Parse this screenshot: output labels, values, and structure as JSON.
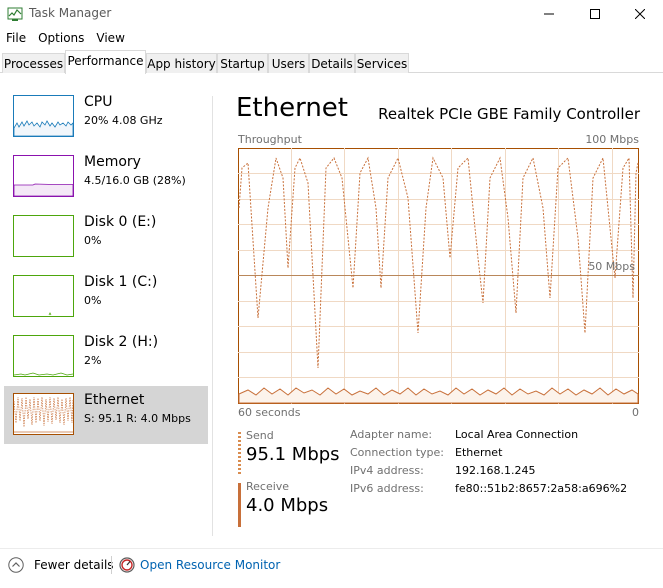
{
  "window": {
    "title": "Task Manager",
    "icon": "task-manager-icon"
  },
  "menu": [
    "File",
    "Options",
    "View"
  ],
  "tabs": [
    "Processes",
    "Performance",
    "App history",
    "Startup",
    "Users",
    "Details",
    "Services"
  ],
  "active_tab": "Performance",
  "sidebar": {
    "items": [
      {
        "title": "CPU",
        "subtitle": "20%  4.08 GHz",
        "color": "#1a7bb9"
      },
      {
        "title": "Memory",
        "subtitle": "4.5/16.0 GB (28%)",
        "color": "#8b12ae"
      },
      {
        "title": "Disk 0 (E:)",
        "subtitle": "0%",
        "color": "#4da60c"
      },
      {
        "title": "Disk 1 (C:)",
        "subtitle": "0%",
        "color": "#4da60c"
      },
      {
        "title": "Disk 2 (H:)",
        "subtitle": "2%",
        "color": "#4da60c"
      },
      {
        "title": "Ethernet",
        "subtitle": "S: 95.1  R: 4.0 Mbps",
        "color": "#a74f01"
      }
    ]
  },
  "main": {
    "title": "Ethernet",
    "device": "Realtek PCIe GBE Family Controller",
    "graph": {
      "label_left": "Throughput",
      "label_max": "100 Mbps",
      "label_mid": "50 Mbps",
      "time_left": "60 seconds",
      "time_right": "0"
    },
    "send": {
      "label": "Send",
      "value": "95.1 Mbps"
    },
    "receive": {
      "label": "Receive",
      "value": "4.0 Mbps"
    },
    "details": [
      {
        "key": "Adapter name:",
        "value": "Local Area Connection"
      },
      {
        "key": "Connection type:",
        "value": "Ethernet"
      },
      {
        "key": "IPv4 address:",
        "value": "192.168.1.245"
      },
      {
        "key": "IPv6 address:",
        "value": "fe80::51b2:8657:2a58:a696%2"
      }
    ]
  },
  "footer": {
    "fewer_details": "Fewer details",
    "open_resource_monitor": "Open Resource Monitor"
  },
  "colors": {
    "ethernet_line": "#c8703a",
    "ethernet_fill": "#fcf3eb",
    "graph_border": "#a74f01",
    "grid": "#f0d9c4",
    "link": "#0063b1"
  }
}
